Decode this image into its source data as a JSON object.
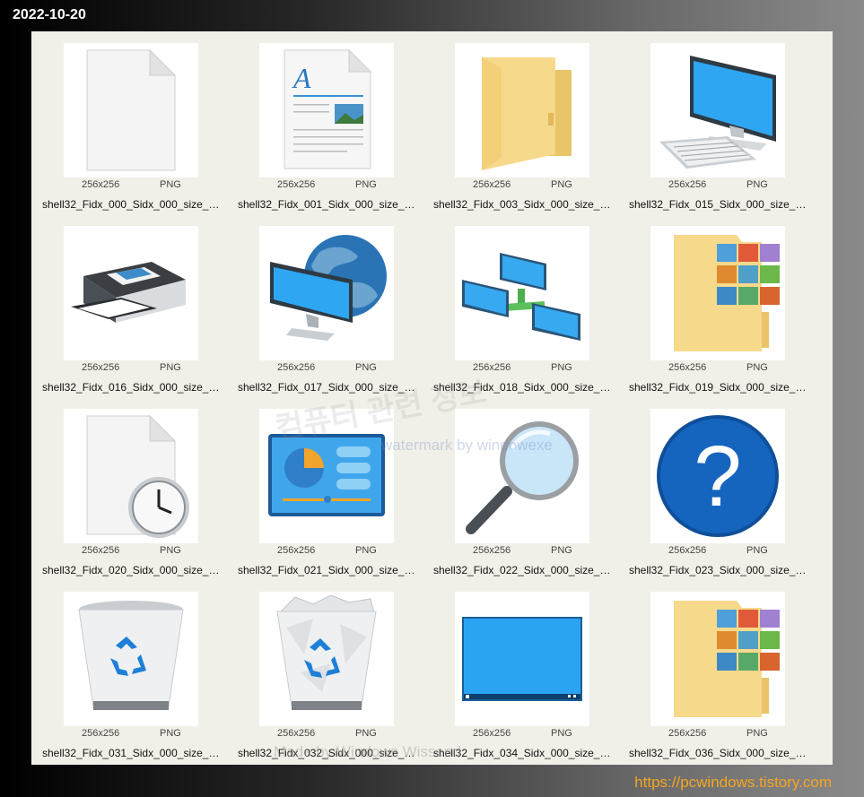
{
  "header": {
    "date": "2022-10-20"
  },
  "footer": {
    "site_url": "https://pcwindows.tistory.com"
  },
  "watermark": {
    "korean": "컴퓨터 관련 정보",
    "english": "watermark by windowexe",
    "bottom": "Made by Windows Wissend"
  },
  "files": [
    {
      "icon": "blank-document-icon",
      "dimensions": "256x256",
      "format": "PNG",
      "name": "shell32_Fidx_000_Sidx_000_size_25..."
    },
    {
      "icon": "text-document-icon",
      "dimensions": "256x256",
      "format": "PNG",
      "name": "shell32_Fidx_001_Sidx_000_size_25..."
    },
    {
      "icon": "folder-icon",
      "dimensions": "256x256",
      "format": "PNG",
      "name": "shell32_Fidx_003_Sidx_000_size_25..."
    },
    {
      "icon": "computer-icon",
      "dimensions": "256x256",
      "format": "PNG",
      "name": "shell32_Fidx_015_Sidx_000_size_25..."
    },
    {
      "icon": "printer-icon",
      "dimensions": "256x256",
      "format": "PNG",
      "name": "shell32_Fidx_016_Sidx_000_size_25..."
    },
    {
      "icon": "network-globe-icon",
      "dimensions": "256x256",
      "format": "PNG",
      "name": "shell32_Fidx_017_Sidx_000_size_25..."
    },
    {
      "icon": "network-icon",
      "dimensions": "256x256",
      "format": "PNG",
      "name": "shell32_Fidx_018_Sidx_000_size_25..."
    },
    {
      "icon": "pictures-folder-icon",
      "dimensions": "256x256",
      "format": "PNG",
      "name": "shell32_Fidx_019_Sidx_000_size_25..."
    },
    {
      "icon": "recent-document-clock-icon",
      "dimensions": "256x256",
      "format": "PNG",
      "name": "shell32_Fidx_020_Sidx_000_size_25..."
    },
    {
      "icon": "control-panel-icon",
      "dimensions": "256x256",
      "format": "PNG",
      "name": "shell32_Fidx_021_Sidx_000_size_25..."
    },
    {
      "icon": "search-magnifier-icon",
      "dimensions": "256x256",
      "format": "PNG",
      "name": "shell32_Fidx_022_Sidx_000_size_25..."
    },
    {
      "icon": "help-question-icon",
      "dimensions": "256x256",
      "format": "PNG",
      "name": "shell32_Fidx_023_Sidx_000_size_25..."
    },
    {
      "icon": "recycle-bin-empty-icon",
      "dimensions": "256x256",
      "format": "PNG",
      "name": "shell32_Fidx_031_Sidx_000_size_25..."
    },
    {
      "icon": "recycle-bin-full-icon",
      "dimensions": "256x256",
      "format": "PNG",
      "name": "shell32_Fidx_032_Sidx_000_size_25..."
    },
    {
      "icon": "desktop-icon",
      "dimensions": "256x256",
      "format": "PNG",
      "name": "shell32_Fidx_034_Sidx_000_size_25..."
    },
    {
      "icon": "pictures-folder-icon",
      "dimensions": "256x256",
      "format": "PNG",
      "name": "shell32_Fidx_036_Sidx_000_size_25..."
    }
  ]
}
